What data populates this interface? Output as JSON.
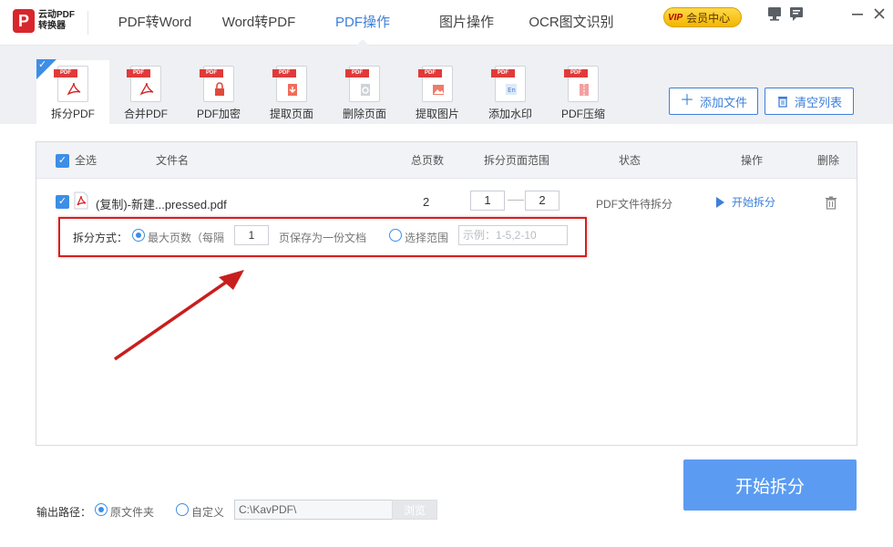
{
  "app": {
    "logo_line1": "云动PDF",
    "logo_line2": "转换器",
    "logo_mark": "P"
  },
  "nav": {
    "tabs": [
      {
        "label": "PDF转Word"
      },
      {
        "label": "Word转PDF"
      },
      {
        "label": "PDF操作"
      },
      {
        "label": "图片操作"
      },
      {
        "label": "OCR图文识别"
      }
    ],
    "active_index": 2,
    "vip_badge": "VIP",
    "vip_label": "会员中心"
  },
  "tools": {
    "items": [
      {
        "label": "拆分PDF",
        "icon": "split-pdf-icon",
        "tag": "PDF"
      },
      {
        "label": "合并PDF",
        "icon": "merge-pdf-icon",
        "tag": "PDF"
      },
      {
        "label": "PDF加密",
        "icon": "encrypt-pdf-icon",
        "tag": "PDF"
      },
      {
        "label": "提取页面",
        "icon": "extract-page-icon",
        "tag": "PDF"
      },
      {
        "label": "删除页面",
        "icon": "delete-page-icon",
        "tag": "PDF"
      },
      {
        "label": "提取图片",
        "icon": "extract-image-icon",
        "tag": "PDF"
      },
      {
        "label": "添加水印",
        "icon": "watermark-icon",
        "tag": "PDF"
      },
      {
        "label": "PDF压缩",
        "icon": "compress-pdf-icon",
        "tag": "PDF"
      }
    ],
    "active_index": 0,
    "add_file": "添加文件",
    "clear_list": "清空列表"
  },
  "table": {
    "headers": {
      "select_all": "全选",
      "filename": "文件名",
      "pages": "总页数",
      "range": "拆分页面范围",
      "status": "状态",
      "action": "操作",
      "delete": "删除"
    },
    "rows": [
      {
        "checked": true,
        "filename": "(复制)-新建...pressed.pdf",
        "pages": "2",
        "range_from": "1",
        "range_to": "2",
        "status": "PDF文件待拆分",
        "action": "开始拆分"
      }
    ],
    "split": {
      "label": "拆分方式：",
      "option_max_pages": "最大页数（每隔",
      "every_value": "1",
      "option_suffix": "页保存为一份文档",
      "option_range": "选择范围",
      "range_placeholder": "示例：1-5,2-10",
      "selected": "max_pages"
    }
  },
  "output": {
    "label": "输出路径：",
    "opt_original": "原文件夹",
    "opt_custom": "自定义",
    "selected": "original",
    "path": "C:\\KavPDF\\",
    "browse": "浏览"
  },
  "start_button": "开始拆分",
  "colors": {
    "accent": "#3d7fd9",
    "checkbox": "#3d8ee6",
    "start_button": "#5b9cf2",
    "highlight": "#d42020",
    "pdf_tag": "#e03a3a"
  }
}
